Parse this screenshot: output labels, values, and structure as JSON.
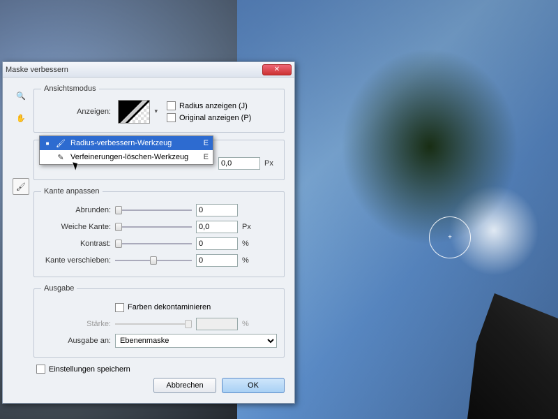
{
  "dialog": {
    "title": "Maske verbessern",
    "close_glyph": "✕",
    "sections": {
      "view": {
        "legend": "Ansichtsmodus",
        "anzeigen_label": "Anzeigen:",
        "radius_anzeigen": "Radius anzeigen (J)",
        "original_anzeigen": "Original anzeigen (P)"
      },
      "edge_detect": {
        "radius_value": "0,0",
        "radius_unit": "Px"
      },
      "edge_adjust": {
        "legend": "Kante anpassen",
        "abrunden_label": "Abrunden:",
        "abrunden_value": "0",
        "weiche_label": "Weiche Kante:",
        "weiche_value": "0,0",
        "weiche_unit": "Px",
        "kontrast_label": "Kontrast:",
        "kontrast_value": "0",
        "kontrast_unit": "%",
        "verschieben_label": "Kante verschieben:",
        "verschieben_value": "0",
        "verschieben_unit": "%"
      },
      "output": {
        "legend": "Ausgabe",
        "decontaminate": "Farben dekontaminieren",
        "staerke_label": "Stärke:",
        "staerke_value": "",
        "staerke_unit": "%",
        "ausgabe_an_label": "Ausgabe an:",
        "ausgabe_an_value": "Ebenenmaske"
      }
    },
    "save_settings": "Einstellungen speichern",
    "cancel": "Abbrechen",
    "ok": "OK"
  },
  "menu": {
    "items": [
      {
        "check": "■",
        "label": "Radius-verbessern-Werkzeug",
        "shortcut": "E",
        "selected": true
      },
      {
        "check": "",
        "label": "Verfeinerungen-löschen-Werkzeug",
        "shortcut": "E",
        "selected": false
      }
    ]
  },
  "icons": {
    "zoom": "🔍",
    "hand": "✋",
    "brush": "🖌",
    "eraser": "✎"
  }
}
